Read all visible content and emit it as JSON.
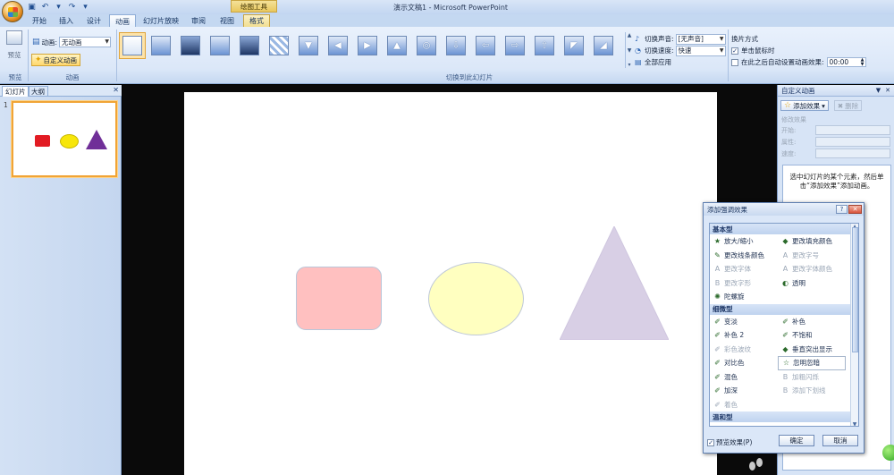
{
  "titlebar": {
    "context_tool": "绘图工具",
    "window_title": "演示文稿1 - Microsoft PowerPoint"
  },
  "tabs": [
    "开始",
    "插入",
    "设计",
    "动画",
    "幻灯片放映",
    "审阅",
    "视图",
    "格式"
  ],
  "active_tab": "动画",
  "ribbon": {
    "preview_label": "预览",
    "preview_group": "预览",
    "anim_label": "动画:",
    "anim_value": "无动画",
    "custom_anim_label": "自定义动画",
    "anim_group": "动画",
    "transition_group": "切换到此幻灯片",
    "sound_label": "切换声音:",
    "sound_value": "[无声音]",
    "speed_label": "切换速度:",
    "speed_value": "快速",
    "apply_all": "全部应用",
    "advance_title": "换片方式",
    "on_click": "单击鼠标时",
    "after_auto": "在此之后自动设置动画效果:",
    "time_value": "00:00"
  },
  "left_pane": {
    "tab_slides": "幻灯片",
    "tab_outline": "大纲",
    "slide_number": "1"
  },
  "colors": {
    "rect_fill": "#ffc0c0",
    "ellipse_fill": "#ffffc0",
    "triangle_fill": "#d8cfe5",
    "thumb_rect": "#e21b23",
    "thumb_ellipse": "#f7e60a",
    "thumb_triangle": "#702f98"
  },
  "task_pane": {
    "title": "自定义动画",
    "add_effect": "添加效果",
    "remove": "删除",
    "modify": "修改效果",
    "start": "开始:",
    "property": "属性:",
    "speed": "速度:",
    "message": "选中幻灯片的某个元素，然后单击“添加效果”添加动画。"
  },
  "dialog": {
    "title": "添加强调效果",
    "categories": [
      {
        "name": "基本型",
        "items": [
          {
            "label": "放大/缩小",
            "icon": "★",
            "dim": false
          },
          {
            "label": "更改填充颜色",
            "icon": "◆",
            "dim": false
          },
          {
            "label": "更改线条颜色",
            "icon": "✎",
            "dim": false
          },
          {
            "label": "更改字号",
            "icon": "A",
            "dim": true
          },
          {
            "label": "更改字体",
            "icon": "A",
            "dim": true
          },
          {
            "label": "更改字体颜色",
            "icon": "A",
            "dim": true
          },
          {
            "label": "更改字形",
            "icon": "B",
            "dim": true
          },
          {
            "label": "透明",
            "icon": "◐",
            "dim": false
          },
          {
            "label": "陀螺旋",
            "icon": "✺",
            "dim": false
          }
        ]
      },
      {
        "name": "细微型",
        "items": [
          {
            "label": "变淡",
            "icon": "✐",
            "dim": false
          },
          {
            "label": "补色",
            "icon": "✐",
            "dim": false
          },
          {
            "label": "补色 2",
            "icon": "✐",
            "dim": false
          },
          {
            "label": "不饱和",
            "icon": "✐",
            "dim": false
          },
          {
            "label": "彩色波纹",
            "icon": "✐",
            "dim": true
          },
          {
            "label": "垂直突出显示",
            "icon": "◆",
            "dim": false
          },
          {
            "label": "对比色",
            "icon": "✐",
            "dim": false
          },
          {
            "label": "忽明忽暗",
            "icon": "☆",
            "dim": false,
            "selected": true
          },
          {
            "label": "混色",
            "icon": "✐",
            "dim": false
          },
          {
            "label": "加粗闪烁",
            "icon": "B",
            "dim": true
          },
          {
            "label": "加深",
            "icon": "✐",
            "dim": false
          },
          {
            "label": "添加下划线",
            "icon": "B",
            "dim": true
          },
          {
            "label": "着色",
            "icon": "✐",
            "dim": true
          }
        ]
      },
      {
        "name": "温和型",
        "items": []
      }
    ],
    "preview_effect": "预览效果(P)",
    "ok": "确定",
    "cancel": "取消"
  }
}
